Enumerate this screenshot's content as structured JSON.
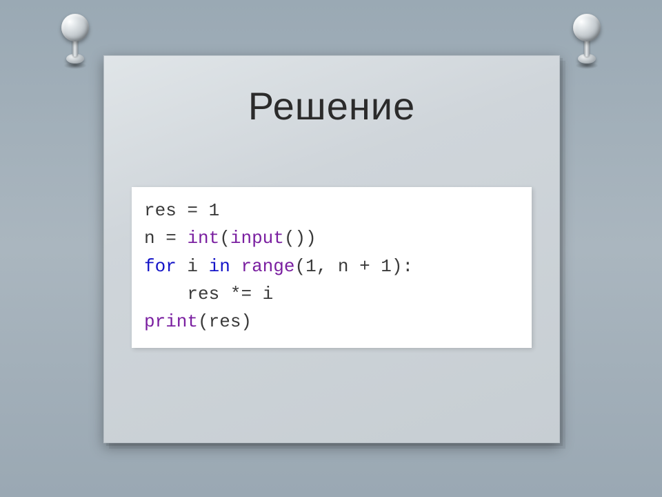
{
  "title": "Решение",
  "code": {
    "line1_var": "res ",
    "line1_op": "= ",
    "line1_num": "1",
    "line2_var": "n ",
    "line2_op": "= ",
    "line2_fn1": "int",
    "line2_paren1": "(",
    "line2_fn2": "input",
    "line2_paren2": "())",
    "line3_kw1": "for",
    "line3_sp1": " ",
    "line3_var1": "i",
    "line3_sp2": " ",
    "line3_kw2": "in",
    "line3_sp3": " ",
    "line3_fn": "range",
    "line3_args": "(1, n + 1):",
    "line4_indent": "    ",
    "line4_var": "res ",
    "line4_op": "*= ",
    "line4_var2": "i",
    "line5_fn": "print",
    "line5_args": "(res)"
  }
}
